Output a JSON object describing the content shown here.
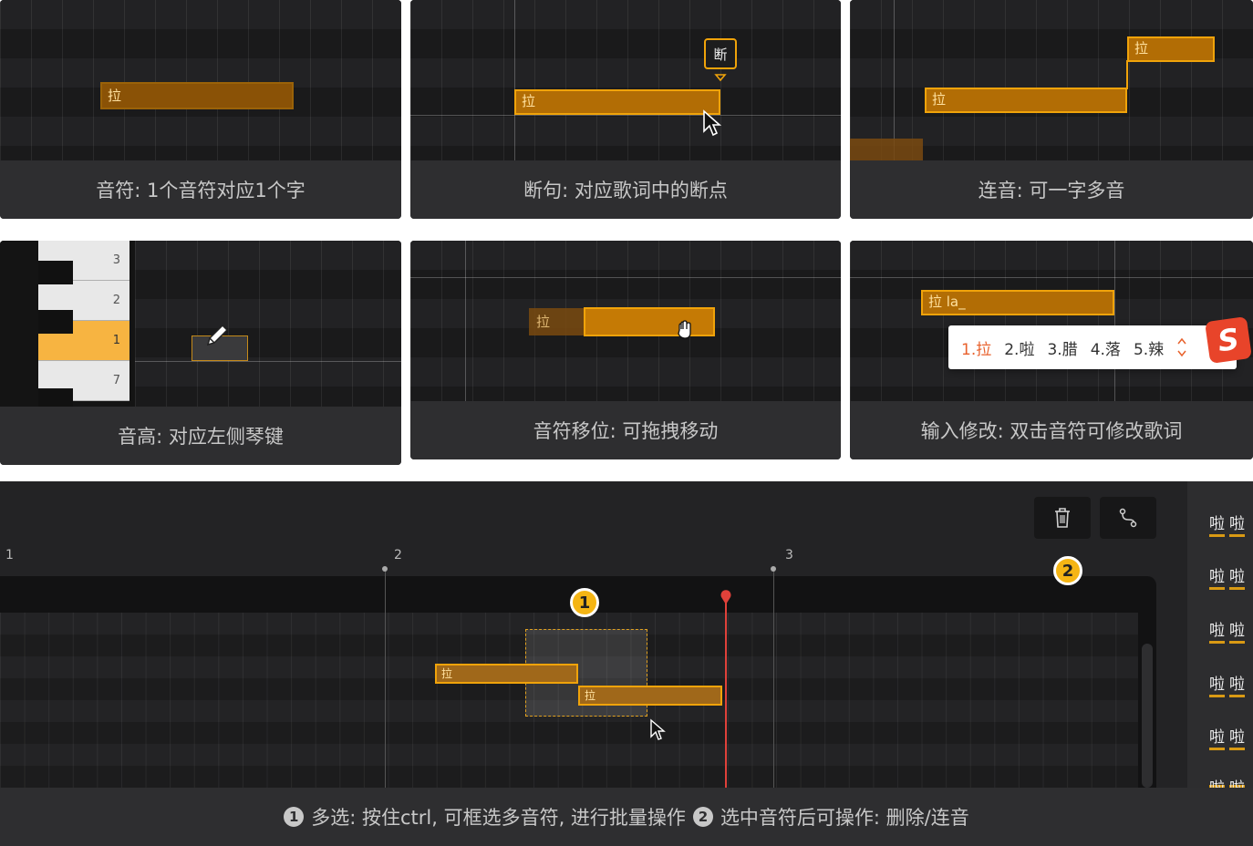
{
  "captions": {
    "p1": "音符: 1个音符对应1个字",
    "p2": "断句: 对应歌词中的断点",
    "p3": "连音: 可一字多音",
    "p4": "音高: 对应左侧琴键",
    "p5": "音符移位: 可拖拽移动",
    "p6": "输入修改: 双击音符可修改歌词"
  },
  "note_label": "拉",
  "break_label": "断",
  "input_text": "拉 la_",
  "piano_keys": [
    "3",
    "2",
    "1",
    "7"
  ],
  "ime": {
    "candidates": [
      "1.拉",
      "2.啦",
      "3.腊",
      "4.落",
      "5.辣"
    ],
    "logo": "S"
  },
  "bottom": {
    "bar_numbers": [
      "1",
      "2",
      "3"
    ],
    "badge1": "1",
    "badge2": "2",
    "lyrics": [
      "啦",
      "啦"
    ],
    "caption_num1": "1",
    "caption_part1": "多选: 按住ctrl, 可框选多音符, 进行批量操作",
    "caption_num2": "2",
    "caption_part2": "选中音符后可操作: 删除/连音"
  },
  "icons": [
    "trash-icon",
    "link-icon",
    "pencil-icon",
    "hand-icon",
    "arrow-cursor-icon"
  ],
  "colors": {
    "accent": "#f0a30a",
    "playhead": "#e0413a",
    "badge": "#f5b514"
  }
}
